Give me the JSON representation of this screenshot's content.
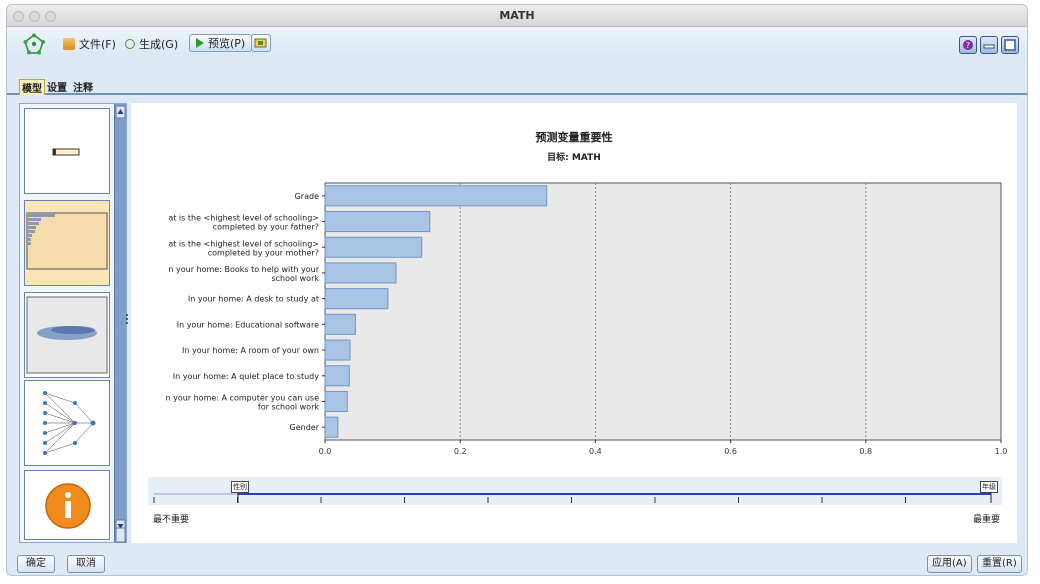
{
  "window": {
    "title": "MATH"
  },
  "menu": {
    "file": "文件(F)",
    "generate": "生成(G)",
    "preview": "预览(P)"
  },
  "tabs": [
    {
      "label": "模型"
    },
    {
      "label": "设置"
    },
    {
      "label": "注释"
    }
  ],
  "chart_data": {
    "type": "bar",
    "orientation": "horizontal",
    "title": "预测变量重要性",
    "subtitle": "目标: MATH",
    "categories": [
      [
        "Grade"
      ],
      [
        "at is the <highest level of schooling>",
        "completed by your father?"
      ],
      [
        "at is the <highest level of schooling>",
        "completed by your mother?"
      ],
      [
        "n your home: Books to help with your",
        "school work"
      ],
      [
        "In your home: A desk to study at"
      ],
      [
        "In your home: Educational software"
      ],
      [
        "In your home: A room of your own"
      ],
      [
        "In your home: A quiet place to study"
      ],
      [
        "n your home: A computer you can use",
        "for school work"
      ],
      [
        "Gender"
      ]
    ],
    "values": [
      0.328,
      0.155,
      0.143,
      0.105,
      0.093,
      0.045,
      0.037,
      0.036,
      0.033,
      0.019
    ],
    "xlim": [
      0,
      1
    ],
    "xticks": [
      "0.0",
      "0.2",
      "0.4",
      "0.6",
      "0.8",
      "1.0"
    ],
    "grid": "vertical-dashed",
    "bar_color": "#a9c4e4",
    "bar_border": "#6f96c4"
  },
  "slider": {
    "left_label": "最不重要",
    "right_label": "最重要",
    "handle_left": "性别",
    "handle_right": "年级"
  },
  "buttons": {
    "ok": "确定",
    "cancel": "取消",
    "apply": "应用(A)",
    "apply_key": "A",
    "reset": "重置(R)",
    "reset_key": "R"
  }
}
